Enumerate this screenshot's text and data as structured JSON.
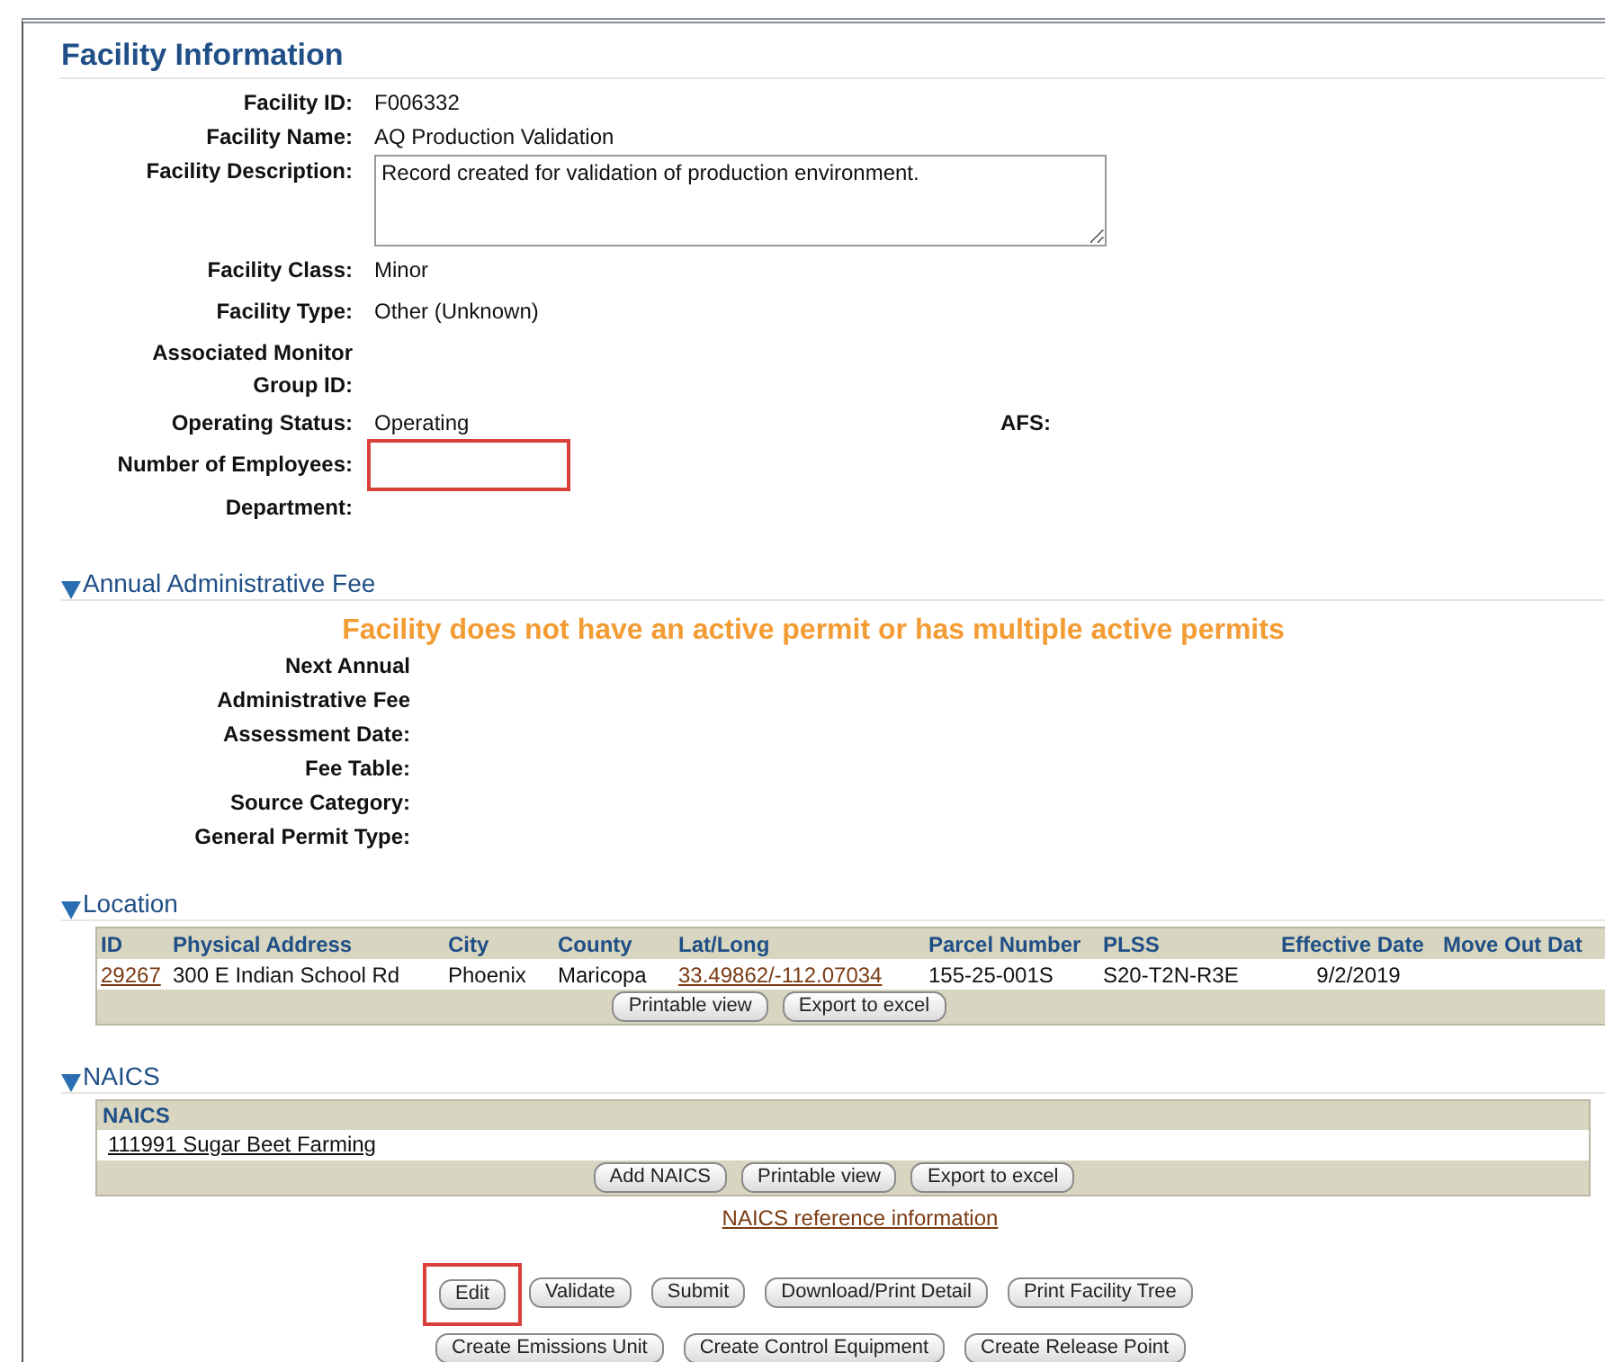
{
  "facility_information": {
    "title": "Facility Information",
    "fields": [
      {
        "label": "Facility ID:",
        "kind": "text",
        "value": "F006332"
      },
      {
        "label": "Facility Name:",
        "kind": "text",
        "value": "AQ Production Validation"
      },
      {
        "label": "Facility Description:",
        "kind": "textarea",
        "value": "Record created for validation of production environment."
      },
      {
        "label": "Facility Class:",
        "kind": "text",
        "value": "Minor"
      },
      {
        "label": "Facility Type:",
        "kind": "text",
        "value": "Other (Unknown)"
      },
      {
        "label": "Associated Monitor\nGroup ID:",
        "kind": "text"
      },
      {
        "label": "Operating Status:",
        "kind": "text",
        "value": "Operating",
        "side_label": "AFS:"
      },
      {
        "label": "Number of Employees:",
        "kind": "input",
        "highlighted": true
      },
      {
        "label": "Department:",
        "kind": "text"
      }
    ]
  },
  "annual_fee": {
    "title": "Annual Administrative Fee",
    "expanded": true,
    "message": "Facility does not have an active permit or has multiple active permits",
    "fields": [
      "Next Annual\nAdministrative Fee",
      "Assessment Date:",
      "Fee Table:",
      "Source Category:",
      "General Permit Type:"
    ]
  },
  "location": {
    "title": "Location",
    "expanded": true,
    "columns": [
      "ID",
      "Physical Address",
      "City",
      "County",
      "Lat/Long",
      "Parcel Number",
      "PLSS",
      "Effective Date",
      "Move Out Dat"
    ],
    "rows": [
      [
        {
          "text": "29267",
          "kind": "link"
        },
        {
          "text": "300 E Indian School Rd"
        },
        {
          "text": "Phoenix"
        },
        {
          "text": "Maricopa"
        },
        {
          "text": "33.49862/-112.07034",
          "kind": "link"
        },
        {
          "text": "155-25-001S"
        },
        {
          "text": "S20-T2N-R3E"
        },
        {
          "text": "9/2/2019"
        },
        {
          "text": ""
        }
      ]
    ],
    "buttons": [
      "Printable view",
      "Export to excel"
    ]
  },
  "naics": {
    "title": "NAICS",
    "expanded": true,
    "column": "NAICS",
    "rows": [
      "111991 Sugar Beet Farming"
    ],
    "buttons": [
      "Add NAICS",
      "Printable view",
      "Export to excel"
    ],
    "reference_link": "NAICS reference information"
  },
  "actions": [
    [
      {
        "label": "Edit",
        "highlighted": true
      },
      {
        "label": "Validate",
        "highlighted": false
      },
      {
        "label": "Submit",
        "highlighted": false
      },
      {
        "label": "Download/Print Detail",
        "highlighted": false
      },
      {
        "label": "Print Facility Tree",
        "highlighted": false
      }
    ],
    [
      {
        "label": "Create Emissions Unit",
        "highlighted": false
      },
      {
        "label": "Create Control Equipment",
        "highlighted": false
      },
      {
        "label": "Create Release Point",
        "highlighted": false
      }
    ]
  ]
}
